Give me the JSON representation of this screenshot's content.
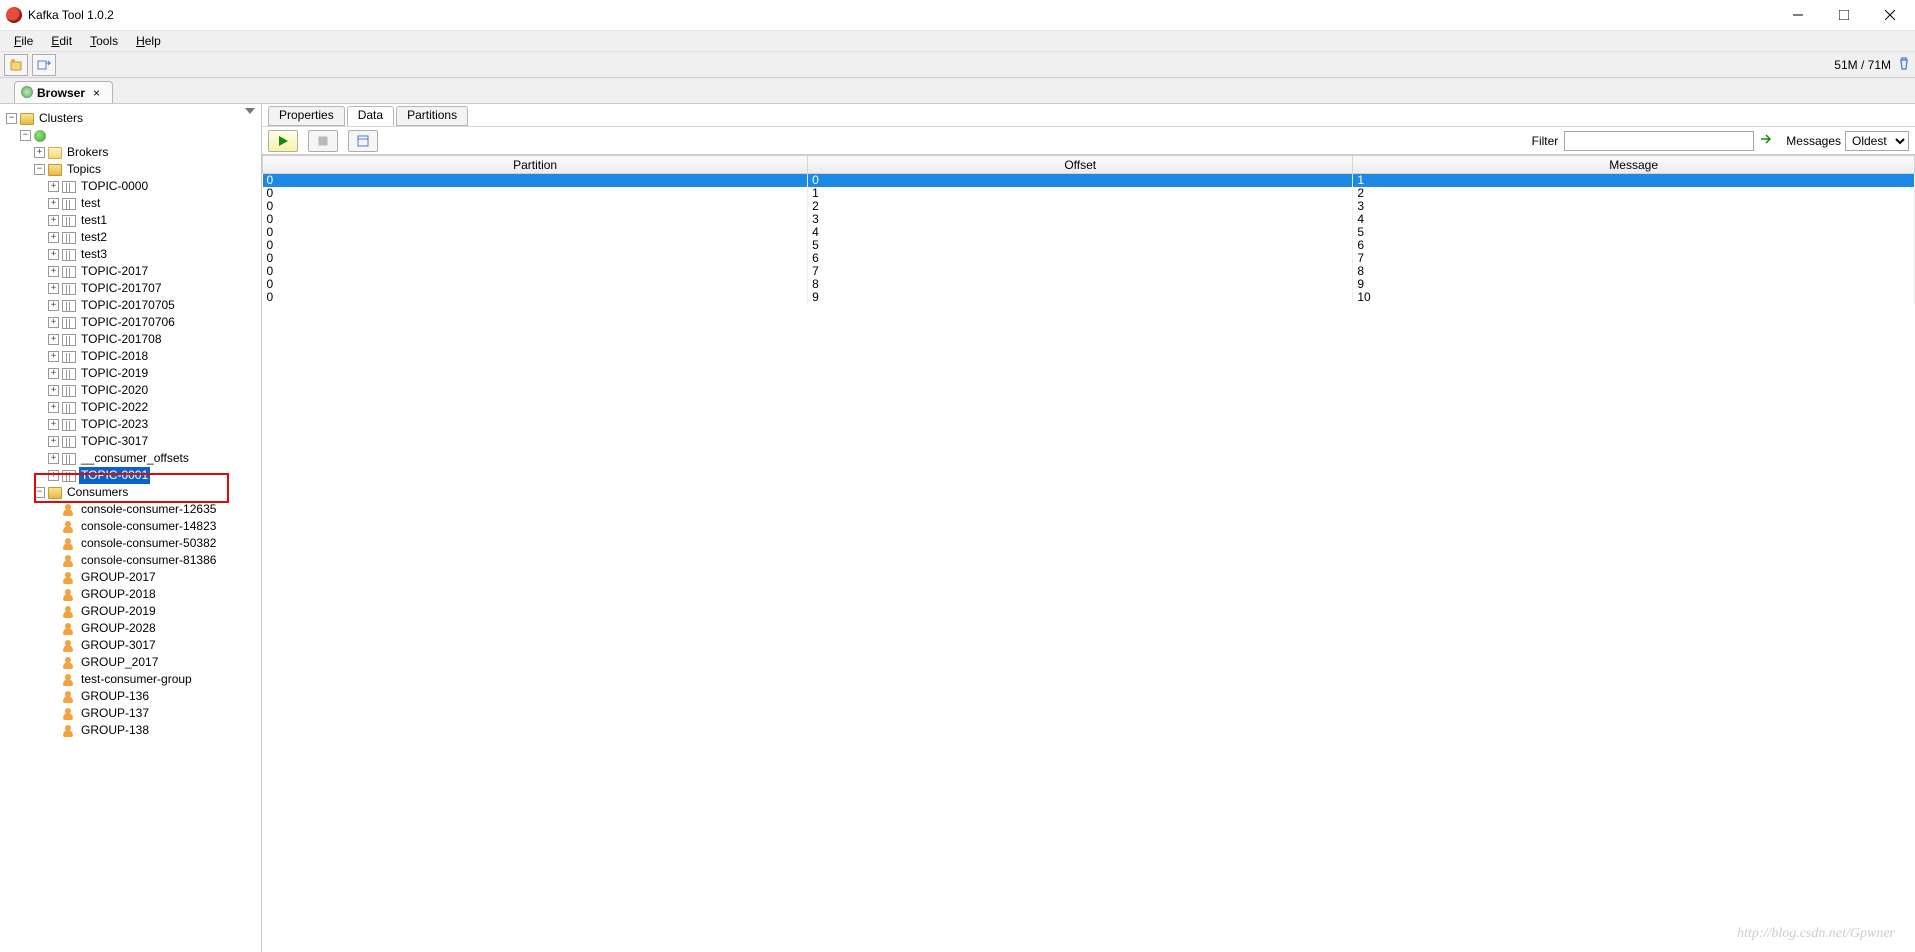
{
  "window": {
    "title": "Kafka Tool  1.0.2"
  },
  "menu": {
    "file": "File",
    "edit": "Edit",
    "tools": "Tools",
    "help": "Help"
  },
  "toolbar_status": {
    "memory": "51M / 71M"
  },
  "browser_tab": {
    "label": "Browser"
  },
  "tree": {
    "root": "Clusters",
    "cluster_blurred": "",
    "brokers": "Brokers",
    "topics": "Topics",
    "topic_items": [
      "TOPIC-0000",
      "test",
      "test1",
      "test2",
      "test3",
      "TOPIC-2017",
      "TOPIC-201707",
      "TOPIC-20170705",
      "TOPIC-20170706",
      "TOPIC-201708",
      "TOPIC-2018",
      "TOPIC-2019",
      "TOPIC-2020",
      "TOPIC-2022",
      "TOPIC-2023",
      "TOPIC-3017",
      "__consumer_offsets",
      "TOPIC-0001"
    ],
    "selected_topic": "TOPIC-0001",
    "consumers": "Consumers",
    "consumer_items": [
      "console-consumer-12635",
      "console-consumer-14823",
      "console-consumer-50382",
      "console-consumer-81386",
      "GROUP-2017",
      "GROUP-2018",
      "GROUP-2019",
      "GROUP-2028",
      "GROUP-3017",
      "GROUP_2017",
      "test-consumer-group",
      "GROUP-136",
      "GROUP-137",
      "GROUP-138"
    ]
  },
  "inner_tabs": {
    "properties": "Properties",
    "data": "Data",
    "partitions": "Partitions",
    "active": "data"
  },
  "content_toolbar": {
    "filter_label": "Filter",
    "filter_value": "",
    "messages_label": "Messages",
    "messages_select": "Oldest"
  },
  "table": {
    "headers": {
      "partition": "Partition",
      "offset": "Offset",
      "message": "Message"
    },
    "rows": [
      {
        "partition": "0",
        "offset": "0",
        "message": "1",
        "selected": true
      },
      {
        "partition": "0",
        "offset": "1",
        "message": "2"
      },
      {
        "partition": "0",
        "offset": "2",
        "message": "3"
      },
      {
        "partition": "0",
        "offset": "3",
        "message": "4"
      },
      {
        "partition": "0",
        "offset": "4",
        "message": "5"
      },
      {
        "partition": "0",
        "offset": "5",
        "message": "6"
      },
      {
        "partition": "0",
        "offset": "6",
        "message": "7"
      },
      {
        "partition": "0",
        "offset": "7",
        "message": "8"
      },
      {
        "partition": "0",
        "offset": "8",
        "message": "9"
      },
      {
        "partition": "0",
        "offset": "9",
        "message": "10"
      }
    ]
  },
  "watermark": "http://blog.csdn.net/Gpwner"
}
